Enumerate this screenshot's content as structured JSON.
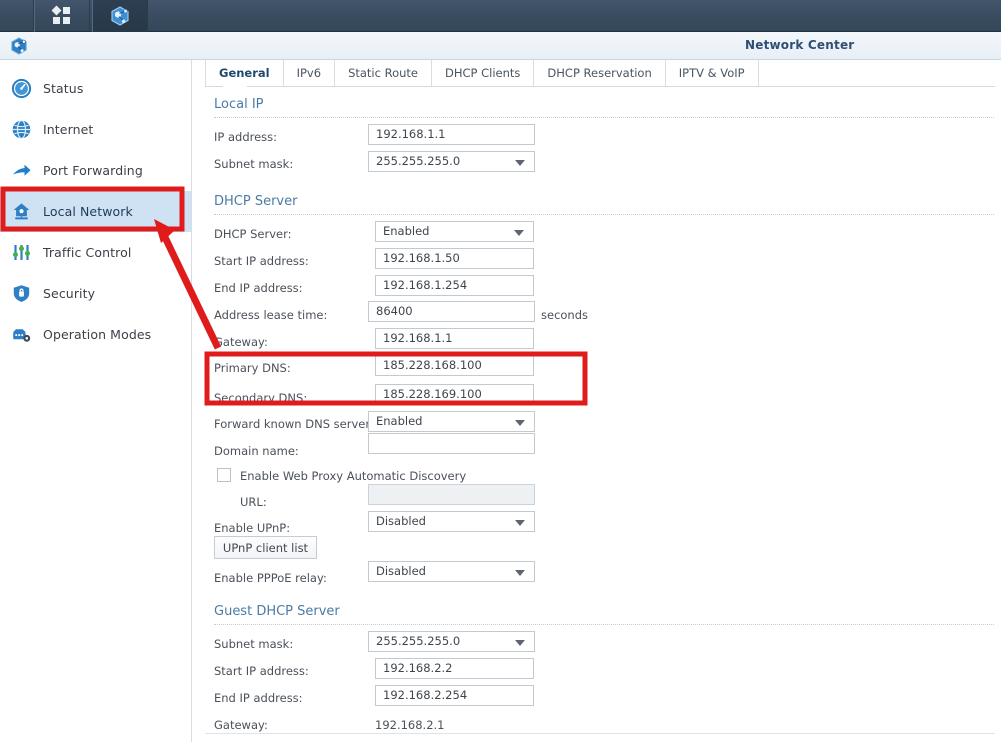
{
  "taskbar": {
    "items": [
      {
        "name": "apps-grid",
        "icon": "grid-icon"
      },
      {
        "name": "network-center-app",
        "icon": "network-globe-icon"
      }
    ]
  },
  "header": {
    "title": "Network Center",
    "icon": "network-globe-icon"
  },
  "sidebar": {
    "items": [
      {
        "label": "Status",
        "icon": "speedometer-icon",
        "active": false
      },
      {
        "label": "Internet",
        "icon": "globe-icon",
        "active": false
      },
      {
        "label": "Port Forwarding",
        "icon": "arrow-forward-icon",
        "active": false
      },
      {
        "label": "Local Network",
        "icon": "home-network-icon",
        "active": true
      },
      {
        "label": "Traffic Control",
        "icon": "sliders-icon",
        "active": false
      },
      {
        "label": "Security",
        "icon": "shield-icon",
        "active": false
      },
      {
        "label": "Operation Modes",
        "icon": "operation-modes-icon",
        "active": false
      }
    ]
  },
  "tabs": [
    {
      "label": "General",
      "selected": true
    },
    {
      "label": "IPv6",
      "selected": false
    },
    {
      "label": "Static Route",
      "selected": false
    },
    {
      "label": "DHCP Clients",
      "selected": false
    },
    {
      "label": "DHCP Reservation",
      "selected": false
    },
    {
      "label": "IPTV & VoIP",
      "selected": false
    }
  ],
  "sections": {
    "local_ip": {
      "title": "Local IP",
      "ip_address": {
        "label": "IP address:",
        "value": "192.168.1.1"
      },
      "subnet_mask": {
        "label": "Subnet mask:",
        "value": "255.255.255.0"
      }
    },
    "dhcp_server": {
      "title": "DHCP Server",
      "dhcp_server": {
        "label": "DHCP Server:",
        "value": "Enabled"
      },
      "start_ip": {
        "label": "Start IP address:",
        "value": "192.168.1.50"
      },
      "end_ip": {
        "label": "End IP address:",
        "value": "192.168.1.254"
      },
      "lease_time": {
        "label": "Address lease time:",
        "value": "86400",
        "unit": "seconds"
      },
      "gateway": {
        "label": "Gateway:",
        "value": "192.168.1.1"
      },
      "primary_dns": {
        "label": "Primary DNS:",
        "value": "185.228.168.100"
      },
      "secondary_dns": {
        "label": "Secondary DNS:",
        "value": "185.228.169.100"
      },
      "forward_dns": {
        "label": "Forward known DNS server:",
        "value": "Enabled"
      },
      "domain_name": {
        "label": "Domain name:",
        "value": ""
      },
      "wpad": {
        "label": "Enable Web Proxy Automatic Discovery",
        "checked": false
      },
      "wpad_url": {
        "label": "URL:",
        "value": ""
      },
      "upnp": {
        "label": "Enable UPnP:",
        "value": "Disabled"
      },
      "upnp_button": {
        "label": "UPnP client list"
      },
      "pppoe_relay": {
        "label": "Enable PPPoE relay:",
        "value": "Disabled"
      }
    },
    "guest_dhcp": {
      "title": "Guest DHCP Server",
      "subnet_mask": {
        "label": "Subnet mask:",
        "value": "255.255.255.0"
      },
      "start_ip": {
        "label": "Start IP address:",
        "value": "192.168.2.2"
      },
      "end_ip": {
        "label": "End IP address:",
        "value": "192.168.2.254"
      },
      "gateway": {
        "label": "Gateway:",
        "value": "192.168.2.1"
      }
    }
  },
  "annotations": {
    "color": "#e01b1b",
    "highlight_box_target": "Local Network",
    "highlight_box_dns": "Primary DNS and Secondary DNS fields",
    "arrow": "points from the DNS fields up-left to the Local Network sidebar item"
  },
  "colors": {
    "taskbar": "#3a4d61",
    "accent_blue": "#2f4f73",
    "section_heading": "#4a7ba6",
    "sidebar_active": "#cfe2f3",
    "annotation_red": "#e01b1b"
  }
}
